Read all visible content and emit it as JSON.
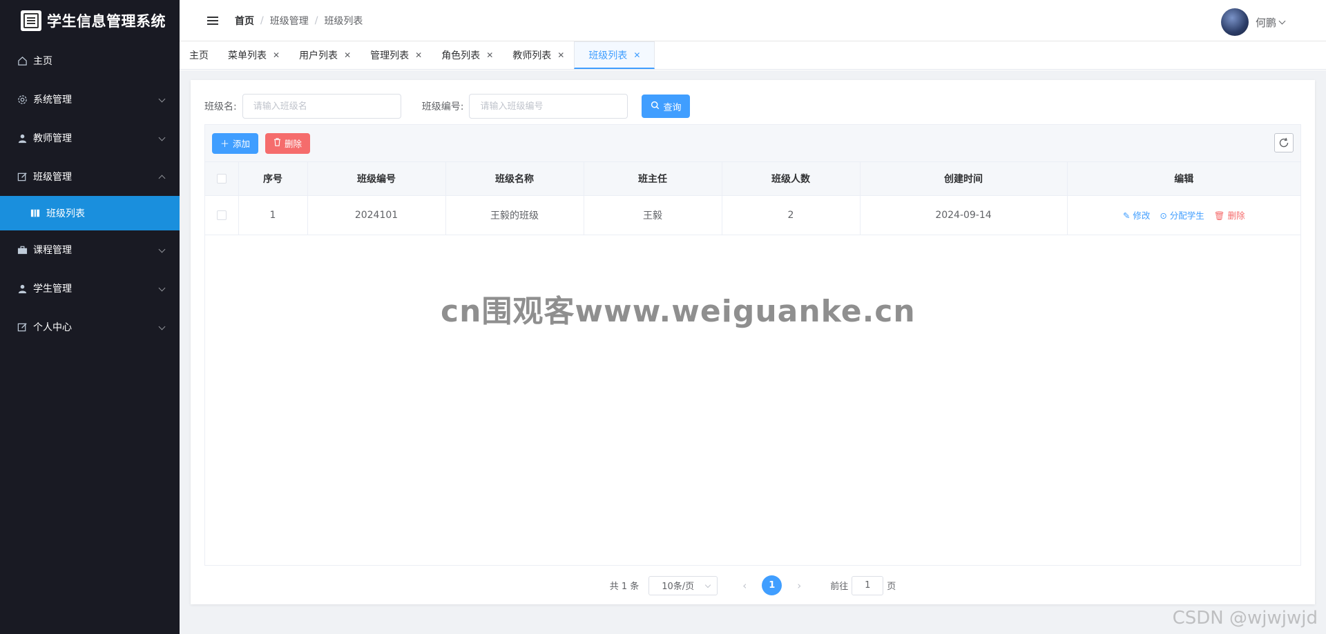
{
  "app": {
    "title": "学生信息管理系统"
  },
  "sidebar": {
    "items": [
      {
        "label": "主页",
        "icon": "home-icon"
      },
      {
        "label": "系统管理",
        "icon": "gear-icon"
      },
      {
        "label": "教师管理",
        "icon": "user-icon"
      },
      {
        "label": "班级管理",
        "icon": "edit-icon",
        "expanded": true
      },
      {
        "label": "班级列表",
        "icon": "book-icon",
        "active": true
      },
      {
        "label": "课程管理",
        "icon": "briefcase-icon"
      },
      {
        "label": "学生管理",
        "icon": "user-icon"
      },
      {
        "label": "个人中心",
        "icon": "edit-icon"
      }
    ]
  },
  "header": {
    "breadcrumb": [
      "首页",
      "班级管理",
      "班级列表"
    ],
    "user_name": "何鹏"
  },
  "tabs": [
    {
      "label": "主页"
    },
    {
      "label": "菜单列表"
    },
    {
      "label": "用户列表"
    },
    {
      "label": "管理列表"
    },
    {
      "label": "角色列表"
    },
    {
      "label": "教师列表"
    },
    {
      "label": "班级列表",
      "active": true
    }
  ],
  "search": {
    "class_name_label": "班级名:",
    "class_name_placeholder": "请输入班级名",
    "class_no_label": "班级编号:",
    "class_no_placeholder": "请输入班级编号",
    "query_label": "查询"
  },
  "toolbar": {
    "add_label": "添加",
    "delete_label": "删除"
  },
  "table": {
    "columns": [
      "序号",
      "班级编号",
      "班级名称",
      "班主任",
      "班级人数",
      "创建时间",
      "编辑"
    ],
    "rows": [
      {
        "index": "1",
        "class_no": "2024101",
        "class_name": "王毅的班级",
        "head_teacher": "王毅",
        "count": "2",
        "created": "2024-09-14"
      }
    ],
    "actions": {
      "edit": "修改",
      "assign": "分配学生",
      "delete": "删除"
    }
  },
  "pagination": {
    "total_text": "共 1 条",
    "page_size": "10条/页",
    "current_page": "1",
    "goto_prefix": "前往",
    "goto_value": "1",
    "goto_suffix": "页"
  },
  "watermarks": {
    "center": "cn围观客www.weiguanke.cn",
    "corner": "CSDN @wjwjwjd"
  },
  "colors": {
    "sidebar_bg": "#191a23",
    "active_menu": "#1a8fdd",
    "primary": "#409eff",
    "danger": "#f56c6c"
  }
}
